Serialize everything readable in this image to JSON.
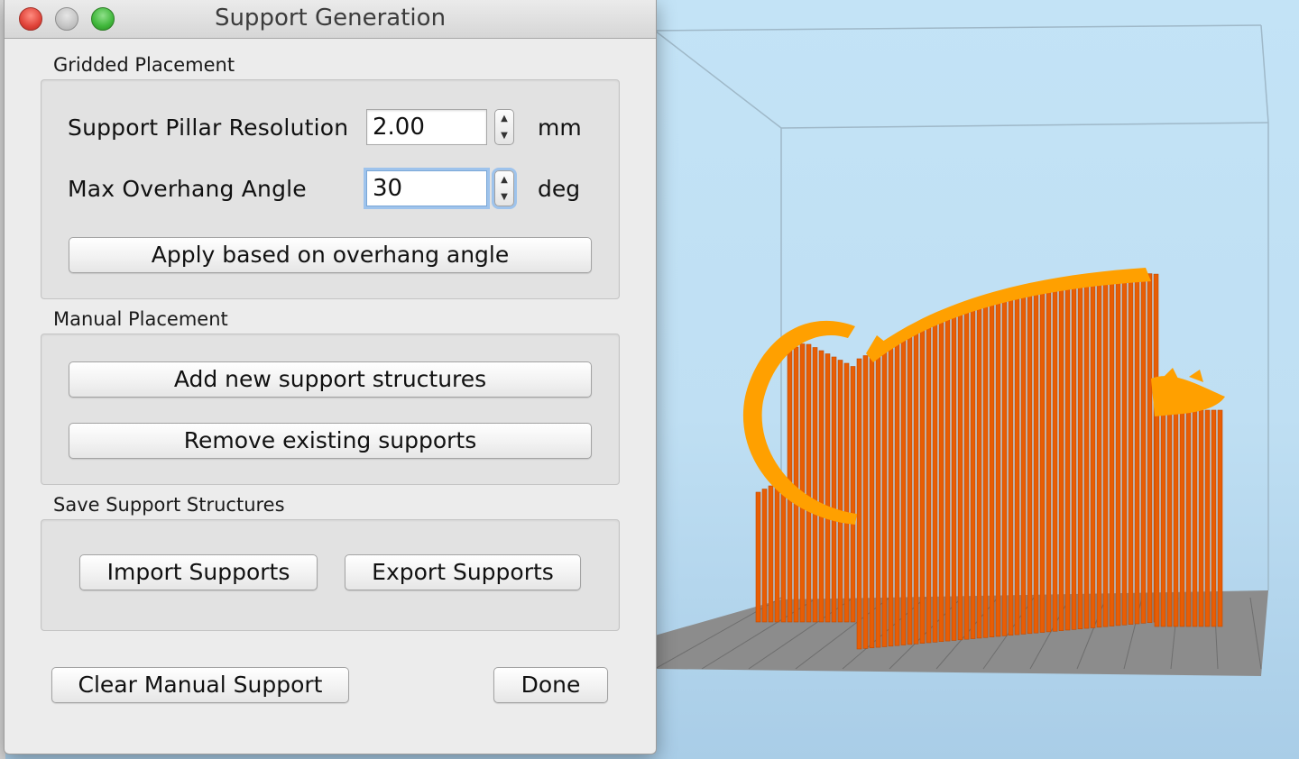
{
  "window": {
    "title": "Support Generation"
  },
  "gridded_placement": {
    "section_label": "Gridded Placement",
    "pillar_resolution": {
      "label": "Support Pillar Resolution",
      "value": "2.00",
      "unit": "mm"
    },
    "overhang_angle": {
      "label": "Max Overhang Angle",
      "value": "30",
      "unit": "deg"
    },
    "apply_button": "Apply based on overhang angle"
  },
  "manual_placement": {
    "section_label": "Manual Placement",
    "add_button": "Add new support structures",
    "remove_button": "Remove existing supports"
  },
  "save_structures": {
    "section_label": "Save Support Structures",
    "import_button": "Import Supports",
    "export_button": "Export Supports"
  },
  "footer": {
    "clear_button": "Clear Manual Support",
    "done_button": "Done"
  },
  "icons": {
    "stepper_up": "▲",
    "stepper_down": "▼"
  },
  "colors": {
    "support_pillar": "#e85d04",
    "model": "#ffa000",
    "build_plate": "#8a8a8a",
    "sky": "#c3e3f6"
  }
}
